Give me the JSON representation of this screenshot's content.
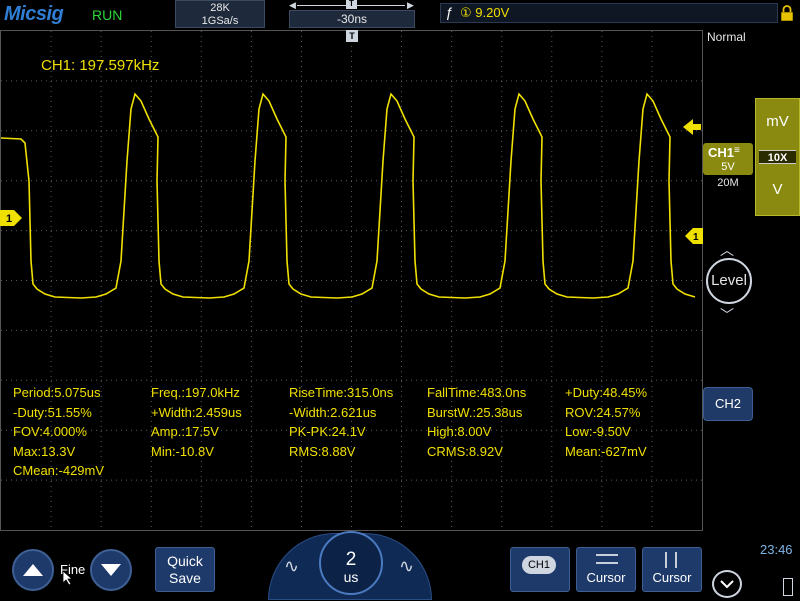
{
  "top": {
    "logo": "Micsig",
    "run_state": "RUN",
    "memory_depth": "28K",
    "sample_rate": "1GSa/s",
    "time_offset": "-30ns",
    "trigger_edge_symbol": "ƒ",
    "trigger_level": "① 9.20V"
  },
  "markers": {
    "trigger_position": "T",
    "ch1_level": "1"
  },
  "display": {
    "frequency_readout": "CH1: 197.597kHz"
  },
  "measurements": [
    [
      "Period:5.075us",
      "Freq.:197.0kHz",
      "RiseTime:315.0ns",
      "FallTime:483.0ns",
      "+Duty:48.45%"
    ],
    [
      "-Duty:51.55%",
      "+Width:2.459us",
      "-Width:2.621us",
      "BurstW.:25.38us",
      "ROV:24.57%"
    ],
    [
      "FOV:4.000%",
      "Amp.:17.5V",
      "PK-PK:24.1V",
      "High:8.00V",
      "Low:-9.50V"
    ],
    [
      "Max:13.3V",
      "Min:-10.8V",
      "RMS:8.88V",
      "CRMS:8.92V",
      "Mean:-627mV"
    ],
    [
      "CMean:-429mV"
    ]
  ],
  "right_panel": {
    "acquire_mode": "Normal",
    "ch1_label": "CH1",
    "ch1_volts_div": "5V",
    "ch1_bandwidth": "20M",
    "scale_up": "mV",
    "probe": "10X",
    "scale_down": "V",
    "level_label": "Level",
    "ch2_label": "CH2"
  },
  "bottom": {
    "fine_label": "Fine",
    "quick_save": "Quick\nSave",
    "timebase_value": "2",
    "timebase_unit": "us",
    "ch1_chip": "CH1",
    "cursor_a": "Cursor",
    "cursor_b": "Cursor",
    "clock": "23:46"
  },
  "colors": {
    "ch1_trace": "#f0e000",
    "grid": "#505050",
    "panel_blue": "#1e3a6a",
    "ch1_scale": "#8a8a10"
  }
}
